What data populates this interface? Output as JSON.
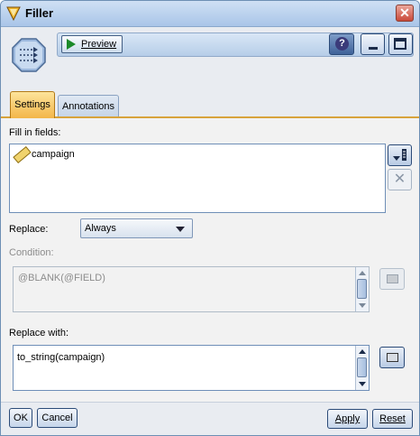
{
  "window": {
    "title": "Filler",
    "close_label": "✕"
  },
  "toolbar": {
    "preview_label": "Preview",
    "help_label": "?"
  },
  "tabs": [
    {
      "label": "Settings",
      "active": true
    },
    {
      "label": "Annotations",
      "active": false
    }
  ],
  "settings": {
    "fill_in_fields_label": "Fill in fields:",
    "fields": [
      "campaign"
    ],
    "delete_label": "✕",
    "replace_label": "Replace:",
    "replace_value": "Always",
    "condition_label": "Condition:",
    "condition_value": "@BLANK(@FIELD)",
    "replace_with_label": "Replace with:",
    "replace_with_value": "to_string(campaign)"
  },
  "footer": {
    "ok_label": "OK",
    "cancel_label": "Cancel",
    "apply_label": "Apply",
    "reset_label": "Reset"
  },
  "colors": {
    "active_tab": "#f3b64a",
    "title_bar": "#a9c5e8",
    "close_button": "#c9493a"
  },
  "icons": {
    "title": "filler-node-icon",
    "node": "filler-node-icon",
    "preview": "play-icon",
    "help": "help-icon",
    "field_type": "ruler-icon",
    "pick_fields": "field-picker-icon",
    "expression_builder": "calculator-icon"
  }
}
